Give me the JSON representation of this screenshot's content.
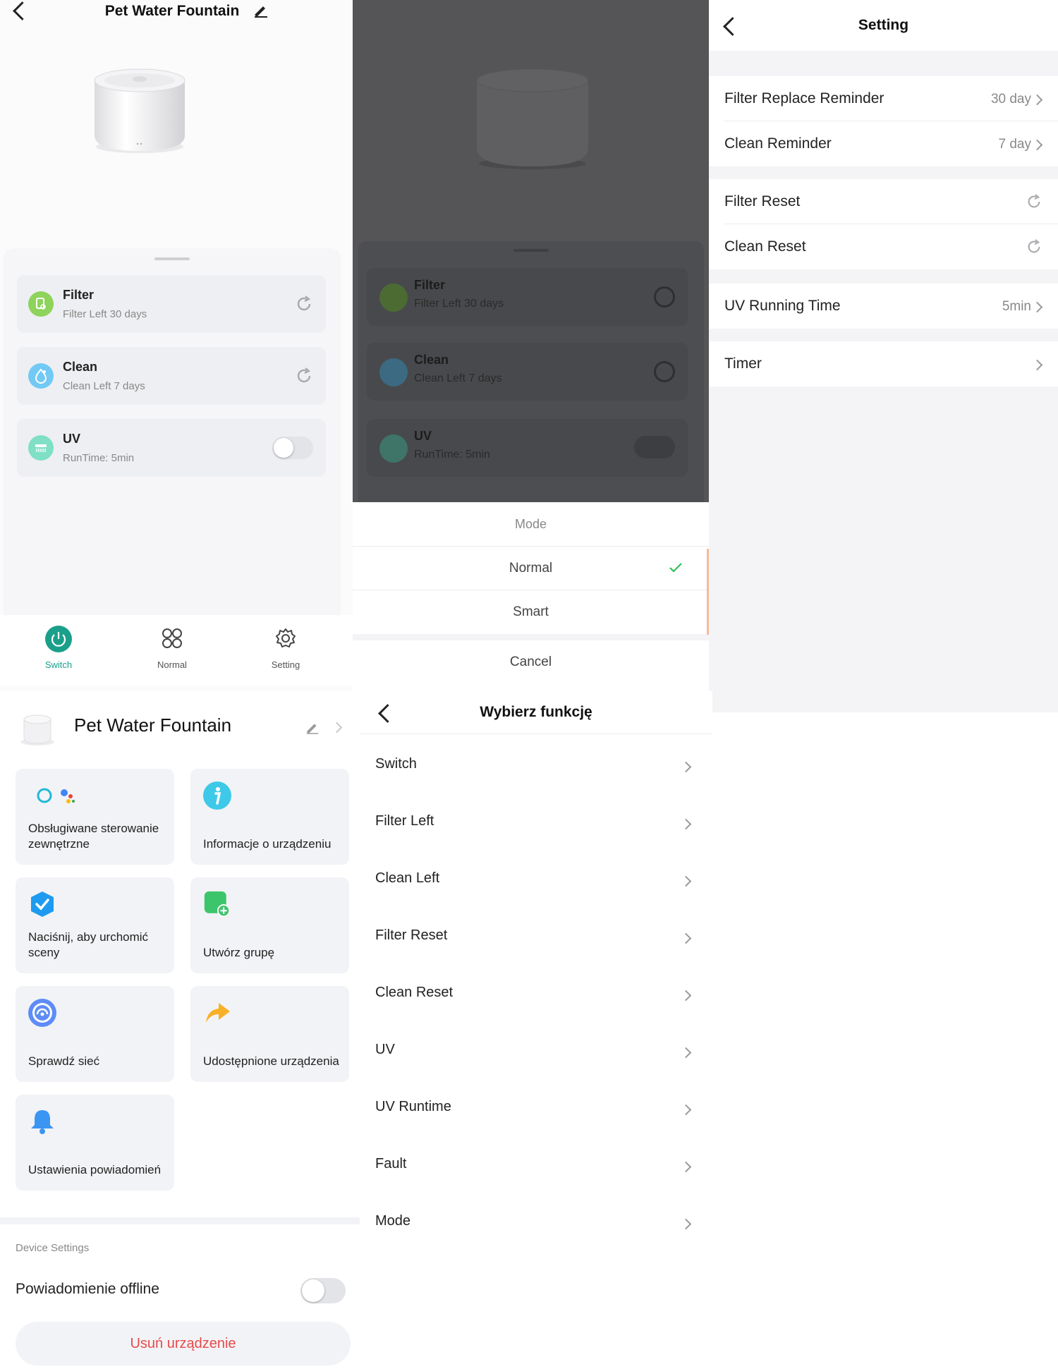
{
  "colors": {
    "accent_teal": "#1a9f8a",
    "filter_green": "#8ed35b",
    "clean_blue": "#73c9f5",
    "uv_mint": "#7fe0c6",
    "danger_red": "#e84a4a",
    "check_green": "#2fbf5a",
    "highlight_orange": "#f7b89c"
  },
  "device_screen": {
    "title": "Pet Water Fountain",
    "cards": [
      {
        "title": "Filter",
        "subtitle": "Filter Left 30 days",
        "icon": "filter-icon"
      },
      {
        "title": "Clean",
        "subtitle": "Clean Left 7 days",
        "icon": "droplet-icon"
      },
      {
        "title": "UV",
        "subtitle": "RunTime: 5min",
        "icon": "uv-lamp-icon"
      }
    ],
    "nav": [
      {
        "label": "Switch",
        "icon": "power-icon"
      },
      {
        "label": "Normal",
        "icon": "mode-grid-icon"
      },
      {
        "label": "Setting",
        "icon": "gear-icon"
      }
    ]
  },
  "mode_popup": {
    "title": "Mode",
    "options": [
      "Normal",
      "Smart"
    ],
    "selected": "Normal",
    "cancel": "Cancel"
  },
  "settings_screen": {
    "title": "Setting",
    "rows": [
      {
        "label": "Filter Replace Reminder",
        "value": "30 day"
      },
      {
        "label": "Clean Reminder",
        "value": "7 day"
      },
      {
        "label": "Filter Reset",
        "value": ""
      },
      {
        "label": "Clean Reset",
        "value": ""
      },
      {
        "label": "UV Running Time",
        "value": "5min"
      },
      {
        "label": "Timer",
        "value": ""
      }
    ]
  },
  "device_settings": {
    "title": "Pet Water Fountain",
    "tiles": [
      {
        "label": "Obsługiwane sterowanie zewnętrzne",
        "icon": "voice-assistant-icon"
      },
      {
        "label": "Informacje o urządzeniu",
        "icon": "info-icon"
      },
      {
        "label": "Naciśnij, aby urchomić sceny",
        "icon": "scene-check-icon"
      },
      {
        "label": "Utwórz grupę",
        "icon": "add-group-icon"
      },
      {
        "label": "Sprawdź sieć",
        "icon": "network-icon"
      },
      {
        "label": "Udostępnione urządzenia",
        "icon": "share-icon"
      },
      {
        "label": "Ustawienia powiadomień",
        "icon": "bell-icon"
      }
    ],
    "section_label": "Device Settings",
    "offline_label": "Powiadomienie offline",
    "remove_label": "Usuń urządzenie"
  },
  "function_list": {
    "title": "Wybierz funkcję",
    "items": [
      "Switch",
      "Filter Left",
      "Clean Left",
      "Filter Reset",
      "Clean Reset",
      "UV",
      "UV Runtime",
      "Fault",
      "Mode"
    ]
  }
}
